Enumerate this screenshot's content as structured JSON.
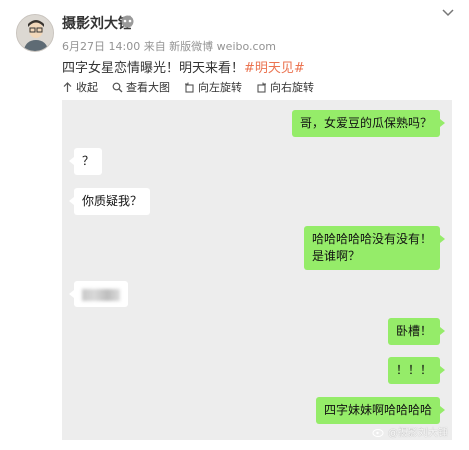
{
  "post": {
    "author": "摄影刘大锤",
    "meta": "6月27日 14:00 来自 新版微博 weibo.com",
    "text": "四字女星恋情曝光！明天来看！",
    "tag": "#明天见#"
  },
  "toolbar": {
    "collapse": "收起",
    "view_large": "查看大图",
    "rotate_left": "向左旋转",
    "rotate_right": "向右旋转"
  },
  "chat": {
    "messages": [
      {
        "side": "right",
        "text": "哥，女爱豆的瓜保熟吗？"
      },
      {
        "side": "left",
        "text": "？"
      },
      {
        "side": "left",
        "text": "你质疑我？"
      },
      {
        "side": "right",
        "text": "哈哈哈哈哈没有没有！"
      },
      {
        "side": "right",
        "text": "是谁啊？"
      },
      {
        "side": "left",
        "text": ""
      },
      {
        "side": "right",
        "text": "卧槽！"
      },
      {
        "side": "right",
        "text": "！！！"
      },
      {
        "side": "right",
        "text": "四字妹妹啊哈哈哈哈"
      }
    ]
  },
  "watermark": "@摄影刘大锤",
  "colors": {
    "bubble_green": "#95ec69",
    "chat_bg": "#ededed",
    "tag_orange": "#eb7350"
  },
  "icons": [
    "vip-icon",
    "more-icon",
    "collapse-icon",
    "zoom-icon",
    "rotate-left-icon",
    "rotate-right-icon",
    "weibo-icon"
  ]
}
